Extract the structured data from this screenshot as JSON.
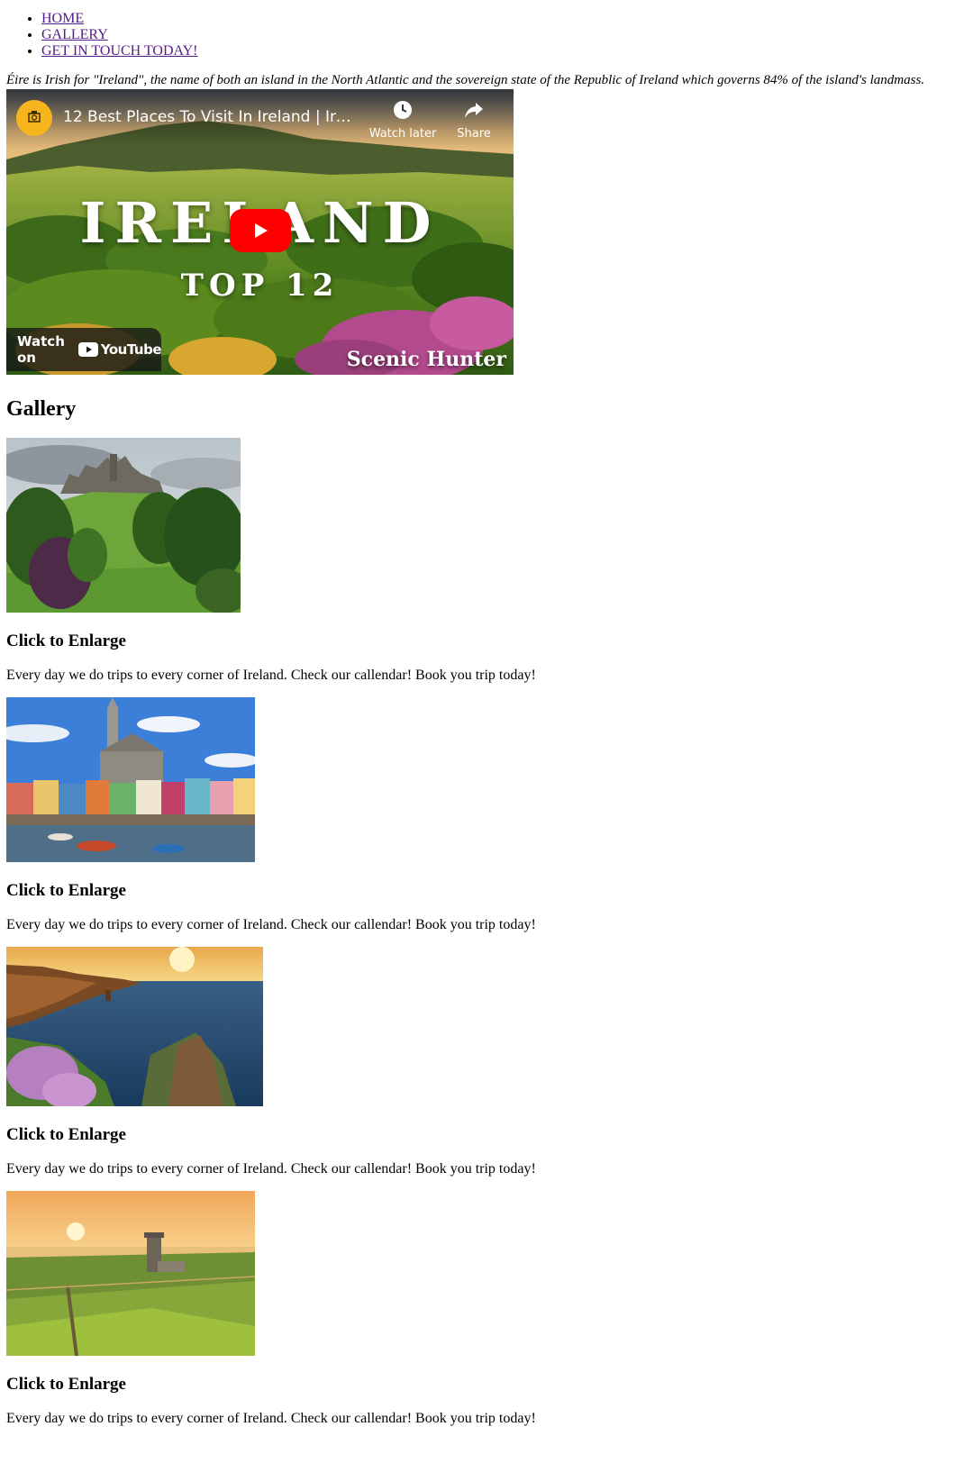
{
  "nav": {
    "items": [
      {
        "label": "HOME"
      },
      {
        "label": "GALLERY"
      },
      {
        "label": "GET IN TOUCH TODAY!"
      }
    ]
  },
  "intro": "Éire is Irish for \"Ireland\", the name of both an island in the North Atlantic and the sovereign state of the Republic of Ireland which governs 84% of the island's landmass.",
  "video": {
    "title": "12 Best Places To Visit In Ireland | Irela…",
    "watch_later": "Watch later",
    "share": "Share",
    "overlay_main": "IRELAND",
    "overlay_sub": "TOP 12",
    "channel_watermark": "Scenic Hunter",
    "watch_on": "Watch on",
    "youtube_label": "YouTube",
    "play_color": "#ff0000"
  },
  "gallery": {
    "title": "Gallery",
    "items": [
      {
        "enlarge": "Click to Enlarge",
        "caption": "Every day we do trips to every corner of Ireland. Check our callendar! Book you trip today!"
      },
      {
        "enlarge": "Click to Enlarge",
        "caption": "Every day we do trips to every corner of Ireland. Check our callendar! Book you trip today!"
      },
      {
        "enlarge": "Click to Enlarge",
        "caption": "Every day we do trips to every corner of Ireland. Check our callendar! Book you trip today!"
      },
      {
        "enlarge": "Click to Enlarge",
        "caption": "Every day we do trips to every corner of Ireland. Check our callendar! Book you trip today!"
      }
    ]
  },
  "colors": {
    "link": "#551a8b",
    "text": "#000000"
  }
}
